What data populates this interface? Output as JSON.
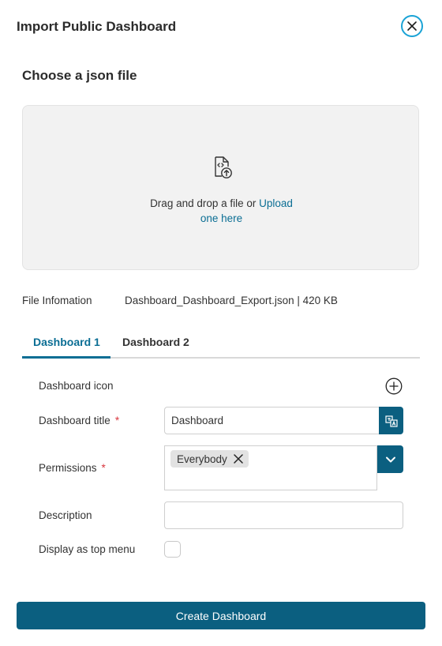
{
  "dialog": {
    "title": "Import Public Dashboard",
    "close_icon": "close-icon"
  },
  "upload": {
    "section_title": "Choose a json file",
    "icon": "file-code-upload-icon",
    "text": "Drag and drop a file or",
    "link_text": "Upload one here"
  },
  "file_info": {
    "label": "File Infomation",
    "value": "Dashboard_Dashboard_Export.json | 420 KB"
  },
  "tabs": [
    {
      "label": "Dashboard 1",
      "active": true
    },
    {
      "label": "Dashboard 2",
      "active": false
    }
  ],
  "form": {
    "icon_label": "Dashboard icon",
    "title_label": "Dashboard title",
    "title_value": "Dashboard",
    "required_mark": "*",
    "permissions_label": "Permissions",
    "permissions_selected": [
      "Everybody"
    ],
    "description_label": "Description",
    "description_value": "",
    "top_menu_label": "Display as top menu",
    "top_menu_checked": false
  },
  "actions": {
    "create_label": "Create Dashboard"
  },
  "colors": {
    "primary": "#0b5f80",
    "link": "#0b6e94",
    "close_ring": "#1aa3d6",
    "required": "#d9363e"
  }
}
